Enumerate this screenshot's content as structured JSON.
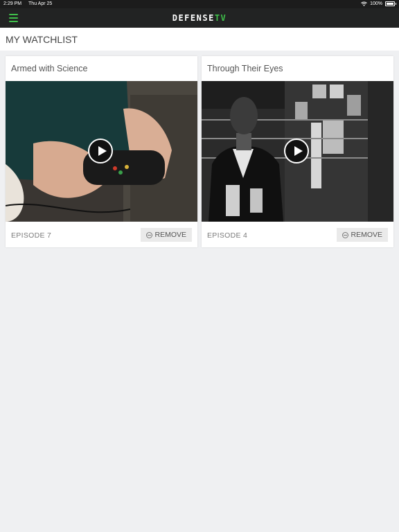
{
  "status_bar": {
    "time": "2:29 PM",
    "date": "Thu Apr 25",
    "battery": "100%"
  },
  "nav": {
    "brand_main": "DEFENSE",
    "brand_accent": "TV",
    "accent_color": "#3fbf4a"
  },
  "page": {
    "title": "MY WATCHLIST"
  },
  "watchlist": [
    {
      "title": "Armed with Science",
      "episode": "EPISODE 7",
      "remove_label": "REMOVE"
    },
    {
      "title": "Through Their Eyes",
      "episode": "EPISODE 4",
      "remove_label": "REMOVE"
    }
  ],
  "icons": {
    "menu": "hamburger-menu-icon",
    "play": "play-icon",
    "remove": "minus-circle-icon",
    "wifi": "wifi-icon",
    "battery": "battery-icon"
  }
}
